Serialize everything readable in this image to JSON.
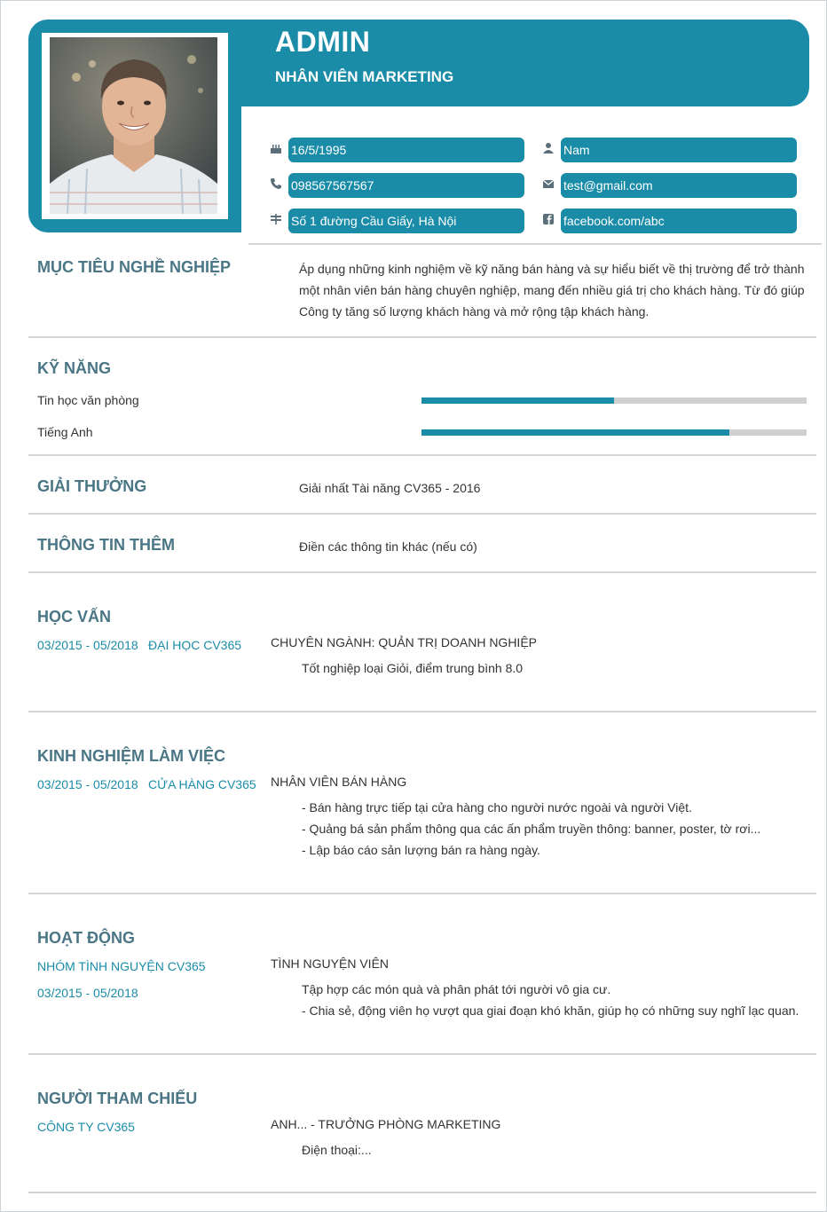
{
  "header": {
    "name": "ADMIN",
    "job_title": "NHÂN VIÊN MARKETING"
  },
  "contact": {
    "birthday": "16/5/1995",
    "gender": "Nam",
    "phone": "098567567567",
    "email": "test@gmail.com",
    "address": "Số 1 đường Cầu Giấy, Hà Nội",
    "facebook": "facebook.com/abc"
  },
  "objective": {
    "title": "MỤC TIÊU NGHỀ NGHIỆP",
    "lines": [
      "Áp dụng những kinh nghiệm về kỹ năng bán hàng và sự hiểu biết về thị trường để trở thành",
      "một nhân viên bán hàng chuyên nghiệp, mang đến nhiều giá trị cho khách hàng. Từ đó giúp",
      "Công ty tăng số lượng khách hàng và mở rộng tập khách hàng."
    ]
  },
  "skills": {
    "title": "KỸ NĂNG",
    "items": [
      {
        "label": "Tin học văn phòng",
        "level": 0.5
      },
      {
        "label": "Tiếng Anh",
        "level": 0.8
      }
    ]
  },
  "awards": {
    "title": "GIẢI THƯỞNG",
    "text": "Giải nhất Tài năng CV365 - 2016"
  },
  "extra": {
    "title": "THÔNG TIN THÊM",
    "text": "Điền các thông tin khác (nếu có)"
  },
  "education": {
    "title": "HỌC VẤN",
    "period": "03/2015 - 05/2018",
    "school": "ĐẠI HỌC CV365",
    "major": "CHUYÊN NGÀNH: QUẢN TRỊ DOANH NGHIỆP",
    "detail": "Tốt nghiệp loại Giỏi, điểm trung bình 8.0"
  },
  "experience": {
    "title": "KINH NGHIỆM LÀM VIỆC",
    "period": "03/2015 - 05/2018",
    "company": "CỬA HÀNG CV365",
    "position": "NHÂN VIÊN BÁN HÀNG",
    "lines": [
      "- Bán hàng trực tiếp tại cửa hàng cho người nước ngoài và người Việt.",
      "- Quảng bá sản phẩm thông qua các ấn phẩm truyền thông: banner, poster, tờ rơi...",
      "- Lập báo cáo sản lượng bán ra hàng ngày."
    ]
  },
  "activities": {
    "title": "HOẠT ĐỘNG",
    "org": "NHÓM TÌNH NGUYỆN CV365",
    "period": "03/2015 - 05/2018",
    "role": "TÌNH NGUYỆN VIÊN",
    "lines": [
      "Tập hợp các món quà và phân phát tới người vô gia cư.",
      "- Chia sẻ, động viên họ vượt qua giai đoạn khó khăn, giúp họ có những suy nghĩ lạc quan."
    ]
  },
  "references": {
    "title": "NGƯỜI THAM CHIẾU",
    "company": "CÔNG TY CV365",
    "person": "ANH... - TRƯỞNG PHÒNG MARKETING",
    "phone": "Điện thoại:..."
  },
  "colors": {
    "accent": "#1b8ca8",
    "heading": "#4a7685",
    "bar_track": "#d0d0d0",
    "divider": "#d4d4d4"
  },
  "icons": {
    "birthday": "birthday-cake-icon",
    "gender": "user-icon",
    "phone": "phone-icon",
    "email": "envelope-icon",
    "address": "map-marker-icon",
    "facebook": "facebook-icon"
  }
}
